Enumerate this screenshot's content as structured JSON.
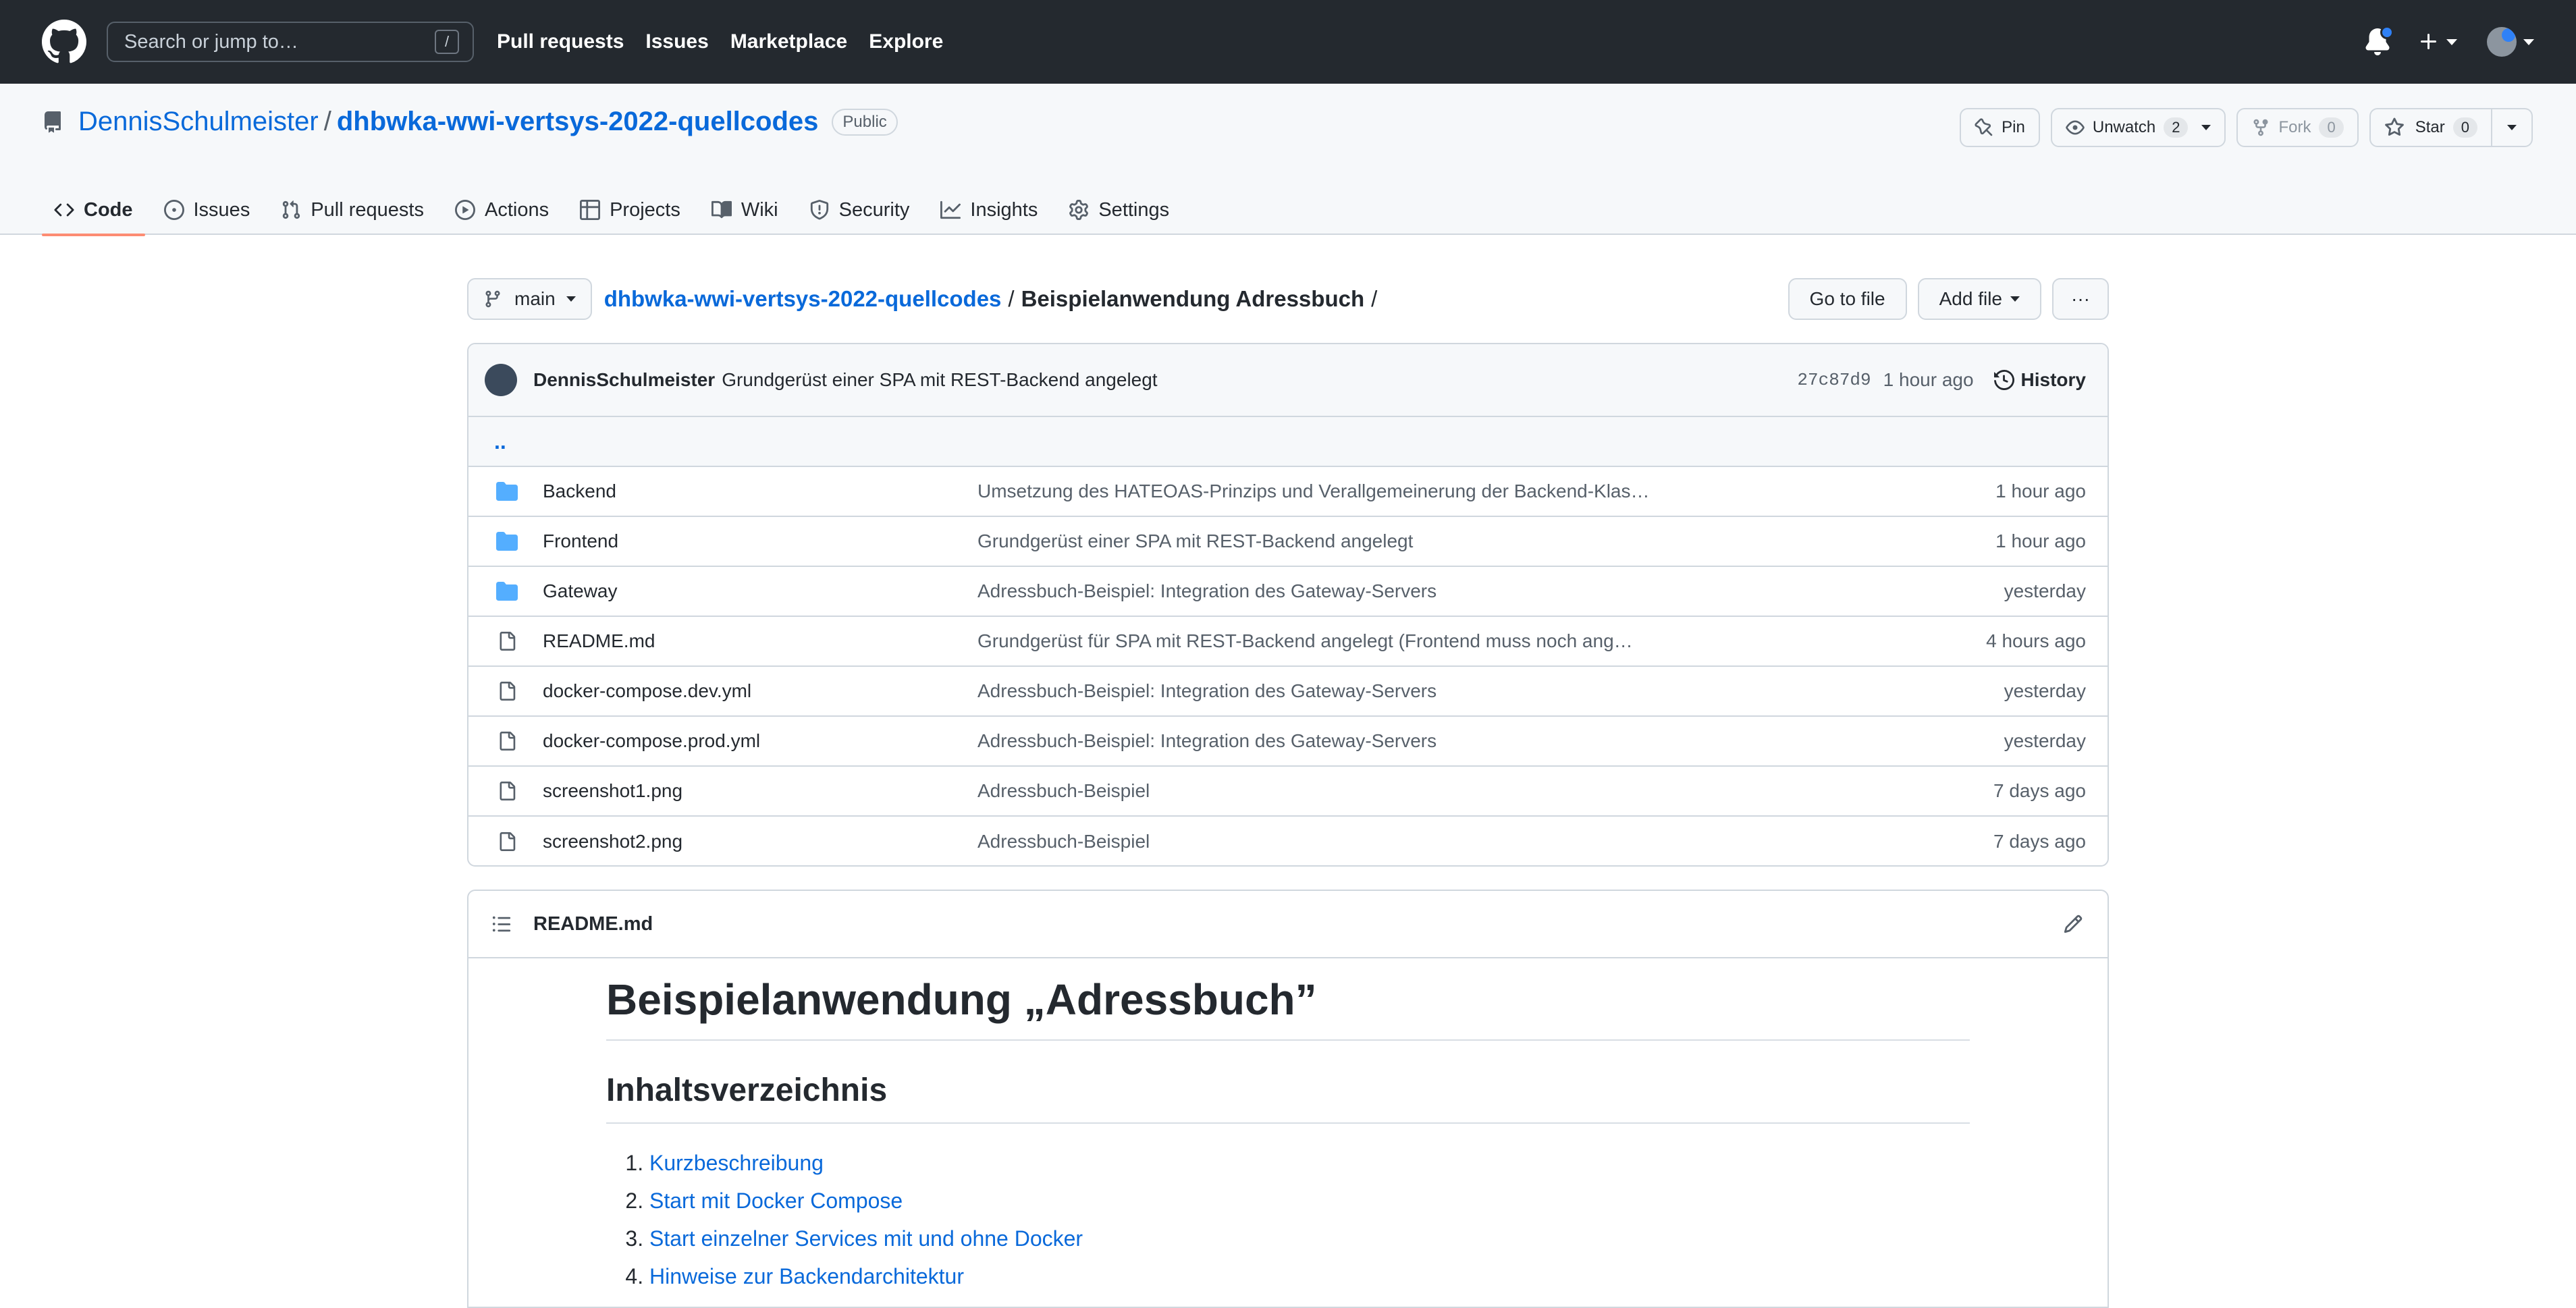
{
  "topnav": {
    "search_placeholder": "Search or jump to…",
    "search_shortcut": "/",
    "links": [
      "Pull requests",
      "Issues",
      "Marketplace",
      "Explore"
    ]
  },
  "repo": {
    "owner": "DennisSchulmeister",
    "separator": "/",
    "name": "dhbwka-wwi-vertsys-2022-quellcodes",
    "visibility": "Public",
    "actions": {
      "pin": "Pin",
      "unwatch": "Unwatch",
      "watch_count": "2",
      "fork": "Fork",
      "fork_count": "0",
      "star": "Star",
      "star_count": "0"
    },
    "tabs": [
      {
        "label": "Code",
        "icon": "code-icon",
        "active": true
      },
      {
        "label": "Issues",
        "icon": "issue-icon"
      },
      {
        "label": "Pull requests",
        "icon": "pull-request-icon"
      },
      {
        "label": "Actions",
        "icon": "play-icon"
      },
      {
        "label": "Projects",
        "icon": "table-icon"
      },
      {
        "label": "Wiki",
        "icon": "book-icon"
      },
      {
        "label": "Security",
        "icon": "shield-icon"
      },
      {
        "label": "Insights",
        "icon": "graph-icon"
      },
      {
        "label": "Settings",
        "icon": "gear-icon"
      }
    ]
  },
  "breadcrumb": {
    "branch": "main",
    "repo_link": "dhbwka-wwi-vertsys-2022-quellcodes",
    "sep": "/",
    "dir": "Beispielanwendung Adressbuch",
    "trailing": "/",
    "go_to_file": "Go to file",
    "add_file": "Add file",
    "more": "···"
  },
  "commit": {
    "author": "DennisSchulmeister",
    "message": "Grundgerüst einer SPA mit REST-Backend angelegt",
    "sha": "27c87d9",
    "when": "1 hour ago",
    "history": "History"
  },
  "files": {
    "up": "..",
    "rows": [
      {
        "type": "dir",
        "name": "Backend",
        "message": "Umsetzung des HATEOAS-Prinzips und Verallgemeinerung der Backend-Klas…",
        "age": "1 hour ago"
      },
      {
        "type": "dir",
        "name": "Frontend",
        "message": "Grundgerüst einer SPA mit REST-Backend angelegt",
        "age": "1 hour ago"
      },
      {
        "type": "dir",
        "name": "Gateway",
        "message": "Adressbuch-Beispiel: Integration des Gateway-Servers",
        "age": "yesterday"
      },
      {
        "type": "file",
        "name": "README.md",
        "message": "Grundgerüst für SPA mit REST-Backend angelegt (Frontend muss noch ang…",
        "age": "4 hours ago"
      },
      {
        "type": "file",
        "name": "docker-compose.dev.yml",
        "message": "Adressbuch-Beispiel: Integration des Gateway-Servers",
        "age": "yesterday"
      },
      {
        "type": "file",
        "name": "docker-compose.prod.yml",
        "message": "Adressbuch-Beispiel: Integration des Gateway-Servers",
        "age": "yesterday"
      },
      {
        "type": "file",
        "name": "screenshot1.png",
        "message": "Adressbuch-Beispiel",
        "age": "7 days ago"
      },
      {
        "type": "file",
        "name": "screenshot2.png",
        "message": "Adressbuch-Beispiel",
        "age": "7 days ago"
      }
    ]
  },
  "readme": {
    "filename": "README.md",
    "h1": "Beispielanwendung „Adressbuch”",
    "h2": "Inhaltsverzeichnis",
    "toc": [
      "Kurzbeschreibung",
      "Start mit Docker Compose",
      "Start einzelner Services mit und ohne Docker",
      "Hinweise zur Backendarchitektur"
    ]
  },
  "colors": {
    "header_bg": "#24292f",
    "link": "#0969da",
    "folder": "#54aeff",
    "active_tab_underline": "#fd8c73",
    "notification_dot": "#2f81f7"
  }
}
